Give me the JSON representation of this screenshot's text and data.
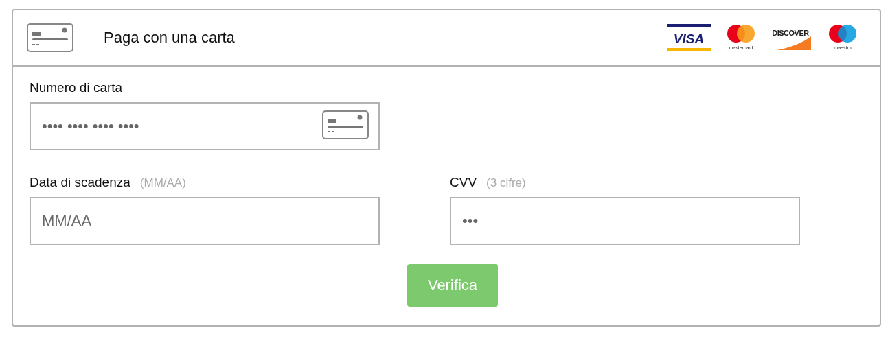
{
  "header": {
    "title": "Paga con una carta"
  },
  "brands": [
    {
      "kind": "visa",
      "label": "VISA"
    },
    {
      "kind": "mastercard",
      "label": "mastercard"
    },
    {
      "kind": "discover",
      "label": "DISCOVER"
    },
    {
      "kind": "maestro",
      "label": "maestro"
    }
  ],
  "card_number": {
    "label": "Numero di carta",
    "placeholder": "•••• •••• •••• ••••"
  },
  "expiry": {
    "label": "Data di scadenza",
    "hint": "(MM/AA)",
    "placeholder": "MM/AA"
  },
  "cvv": {
    "label": "CVV",
    "hint": "(3 cifre)",
    "placeholder": "•••"
  },
  "button": {
    "label": "Verifica"
  }
}
